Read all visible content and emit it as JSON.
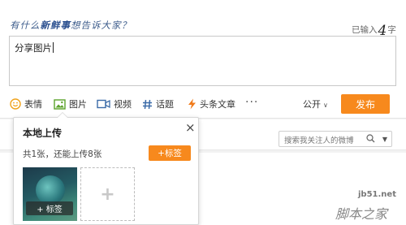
{
  "compose": {
    "prompt_prefix": "有什么",
    "prompt_highlight": "新鲜事",
    "prompt_suffix": "想告诉大家？",
    "counter_prefix": "已输入",
    "counter_value": "4",
    "counter_suffix": "字",
    "text_value": "分享图片"
  },
  "toolbar": {
    "emoji": "表情",
    "image": "图片",
    "video": "视频",
    "topic": "话题",
    "article": "头条文章",
    "more": "···",
    "visibility": "公开",
    "publish": "发布"
  },
  "feed": {
    "search_placeholder": "搜索我关注人的微博"
  },
  "upload_popup": {
    "title": "本地上传",
    "close": "×",
    "count_text": "共1张，还能上传8张",
    "tag_button": "+标签",
    "thumb_tag": "+ 标签",
    "add_symbol": "+"
  },
  "watermark": {
    "line1": "jb51.net",
    "line2": "脚本之家"
  },
  "colors": {
    "accent": "#f7891d",
    "prompt": "#3a5a8a"
  }
}
